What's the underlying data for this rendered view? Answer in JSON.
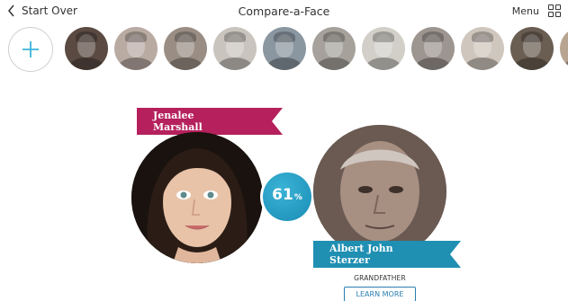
{
  "topbar": {
    "back_label": "Start Over",
    "title": "Compare-a-Face",
    "menu_label": "Menu"
  },
  "strip": {
    "add_icon": "plus-icon",
    "thumbnails": [
      {
        "name": "ancestor-thumbnail",
        "tone": "#5a4a42"
      },
      {
        "name": "ancestor-thumbnail",
        "tone": "#b9aaa2"
      },
      {
        "name": "ancestor-thumbnail",
        "tone": "#9a8e84"
      },
      {
        "name": "ancestor-thumbnail",
        "tone": "#c9c4bd"
      },
      {
        "name": "ancestor-thumbnail",
        "tone": "#8a96a0"
      },
      {
        "name": "ancestor-thumbnail",
        "tone": "#a6a29b"
      },
      {
        "name": "ancestor-thumbnail",
        "tone": "#d2cfc9"
      },
      {
        "name": "ancestor-thumbnail",
        "tone": "#9d9690"
      },
      {
        "name": "ancestor-thumbnail",
        "tone": "#cfc6bd"
      },
      {
        "name": "ancestor-thumbnail",
        "tone": "#6a5d52"
      },
      {
        "name": "ancestor-thumbnail",
        "tone": "#b8a591"
      }
    ]
  },
  "comparison": {
    "user_name": "Jenalee Marshall",
    "match_value": "61",
    "match_unit": "%",
    "ancestor_name": "Albert John Sterzer",
    "relationship": "GRANDFATHER",
    "learn_more_label": "LEARN MORE"
  },
  "colors": {
    "user_banner": "#b5205d",
    "ancestor_banner": "#1f8fb2",
    "match_circle": "#1a8cb4",
    "accent_plus": "#3bb5d8"
  }
}
